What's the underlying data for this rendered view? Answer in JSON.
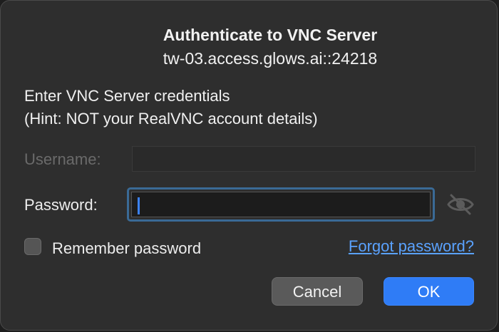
{
  "dialog": {
    "title": "Authenticate to VNC Server",
    "server": "tw-03.access.glows.ai::24218",
    "prompt_line1": "Enter VNC Server credentials",
    "prompt_line2": "(Hint: NOT your RealVNC account details)"
  },
  "form": {
    "username_label": "Username:",
    "username_value": "",
    "username_enabled": false,
    "password_label": "Password:",
    "password_value": "",
    "password_visibility_icon": "eye-slash-icon",
    "remember_label": "Remember password",
    "remember_checked": false,
    "forgot_link": "Forgot password?"
  },
  "buttons": {
    "cancel_label": "Cancel",
    "ok_label": "OK"
  },
  "colors": {
    "dialog_bg": "#2e2e2e",
    "accent": "#2f7cf6",
    "link": "#5aa2ff",
    "focus_ring": "#3a6a96"
  }
}
